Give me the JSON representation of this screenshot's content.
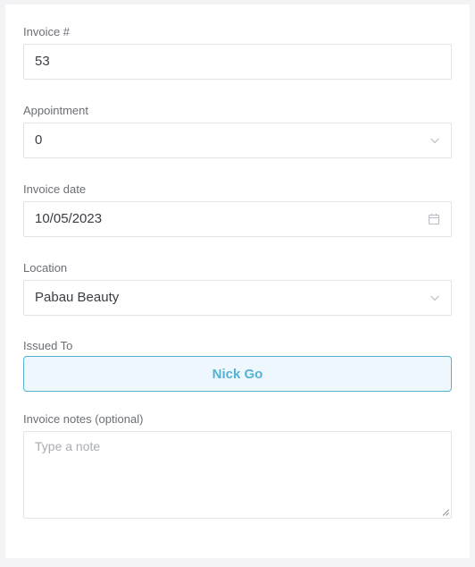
{
  "invoice_number": {
    "label": "Invoice #",
    "value": "53"
  },
  "appointment": {
    "label": "Appointment",
    "value": "0"
  },
  "invoice_date": {
    "label": "Invoice date",
    "value": "10/05/2023"
  },
  "location": {
    "label": "Location",
    "value": "Pabau Beauty"
  },
  "issued_to": {
    "label": "Issued To",
    "value": "Nick Go"
  },
  "invoice_notes": {
    "label": "Invoice notes (optional)",
    "placeholder": "Type a note"
  },
  "colors": {
    "accent": "#54b2d3",
    "accent_bg": "#eef7fd",
    "border": "#e1e3e8",
    "label": "#6b6e76",
    "text": "#3a3d45"
  },
  "icons": {
    "select_arrow": "chevron-down-icon",
    "date_picker": "calendar-icon"
  }
}
